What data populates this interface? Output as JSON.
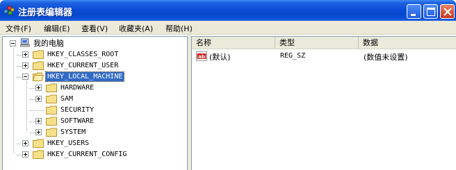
{
  "window": {
    "title": "注册表编辑器",
    "icon": "regedit-icon"
  },
  "menu": [
    "文件(F)",
    "编辑(E)",
    "查看(V)",
    "收藏夹(A)",
    "帮助(H)"
  ],
  "tree": {
    "root": "我的电脑",
    "keys": [
      "HKEY_CLASSES_ROOT",
      "HKEY_CURRENT_USER",
      "HKEY_LOCAL_MACHINE",
      "HKEY_USERS",
      "HKEY_CURRENT_CONFIG"
    ],
    "selected": "HKEY_LOCAL_MACHINE",
    "children": [
      "HARDWARE",
      "SAM",
      "SECURITY",
      "SOFTWARE",
      "SYSTEM"
    ]
  },
  "list": {
    "columns": [
      "名称",
      "类型",
      "数据"
    ],
    "rows": [
      {
        "name": "(默认)",
        "type": "REG_SZ",
        "data": "(数值未设置)"
      }
    ]
  }
}
